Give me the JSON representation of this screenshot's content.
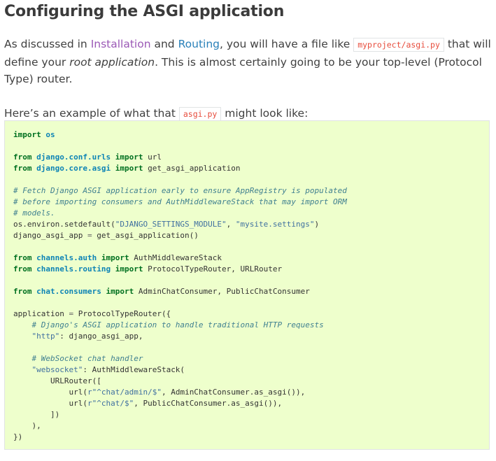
{
  "heading": "Configuring the ASGI application",
  "intro": {
    "p1": "As discussed in ",
    "link1": "Installation",
    "p2": " and ",
    "link2": "Routing",
    "p3": ", you will have a file like ",
    "code": "myproject/asgi.py",
    "p4": " that will define your ",
    "em": "root application",
    "p5": ". This is almost certainly going to be your top-level (Protocol Type) router."
  },
  "example": {
    "p1": "Here’s an example of what that ",
    "code": "asgi.py",
    "p2": " might look like:"
  },
  "code": {
    "import_os": {
      "kw": "import",
      "mod": "os"
    },
    "from_url": {
      "kw1": "from",
      "mod": "django.conf.urls",
      "kw2": "import",
      "rest": "url"
    },
    "from_asgi": {
      "kw1": "from",
      "mod": "django.core.asgi",
      "kw2": "import",
      "rest": "get_asgi_application"
    },
    "comment1": "# Fetch Django ASGI application early to ensure AppRegistry is populated",
    "comment2": "# before importing consumers and AuthMiddlewareStack that may import ORM",
    "comment3": "# models.",
    "setdefault_pre": "os.environ.setdefault(",
    "setdefault_s1": "\"DJANGO_SETTINGS_MODULE\"",
    "setdefault_mid": ", ",
    "setdefault_s2": "\"mysite.settings\"",
    "setdefault_post": ")",
    "django_app_lhs": "django_asgi_app ",
    "django_app_eq": "=",
    "django_app_rhs": " get_asgi_application()",
    "from_auth": {
      "kw1": "from",
      "mod": "channels.auth",
      "kw2": "import",
      "rest": "AuthMiddlewareStack"
    },
    "from_routing": {
      "kw1": "from",
      "mod": "channels.routing",
      "kw2": "import",
      "rest": "ProtocolTypeRouter, URLRouter"
    },
    "from_consumers": {
      "kw1": "from",
      "mod": "chat.consumers",
      "kw2": "import",
      "rest": "AdminChatConsumer, PublicChatConsumer"
    },
    "application_lhs": "application ",
    "application_eq": "=",
    "application_rhs": " ProtocolTypeRouter({",
    "comment_http": "# Django's ASGI application to handle traditional HTTP requests",
    "http_key": "\"http\"",
    "http_val": ": django_asgi_app,",
    "comment_ws": "# WebSocket chat handler",
    "ws_key": "\"websocket\"",
    "ws_val": ": AuthMiddlewareStack(",
    "urlrouter": "URLRouter([",
    "url1_pre": "url(",
    "url1_s": "r\"^chat/admin/$\"",
    "url1_post": ", AdminChatConsumer.as_asgi()),",
    "url2_pre": "url(",
    "url2_s": "r\"^chat/$\"",
    "url2_post": ", PublicChatConsumer.as_asgi()),",
    "close_list": "])",
    "close_stack": "),",
    "close_app": "})"
  }
}
